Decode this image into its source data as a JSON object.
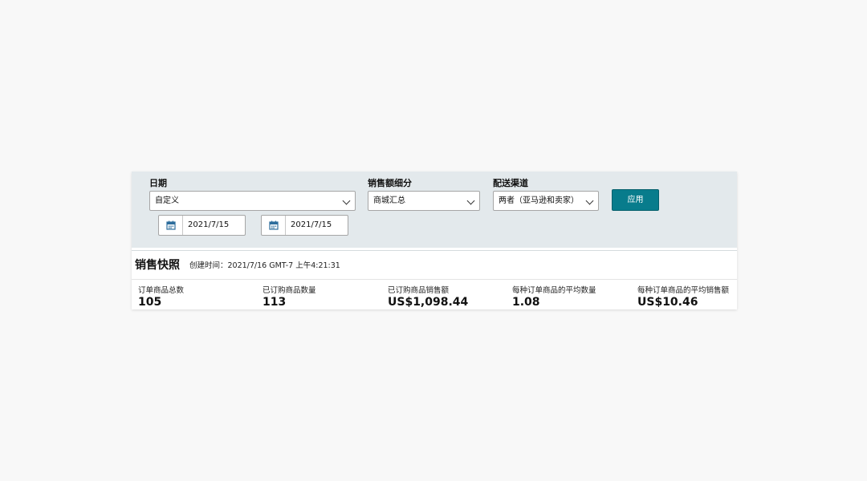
{
  "filters": {
    "date": {
      "label": "日期",
      "selected": "自定义",
      "start_date": "2021/7/15",
      "end_date": "2021/7/15"
    },
    "sales_breakdown": {
      "label": "销售额细分",
      "selected": "商城汇总"
    },
    "fulfillment_channel": {
      "label": "配送渠道",
      "selected": "两者（亚马逊和卖家）"
    },
    "apply_label": "应用"
  },
  "snapshot": {
    "title": "销售快照",
    "created": "创建时间：2021/7/16 GMT-7 上午4:21:31",
    "metrics": [
      {
        "label": "订单商品总数",
        "value": "105"
      },
      {
        "label": "已订购商品数量",
        "value": "113"
      },
      {
        "label": "已订购商品销售额",
        "value": "US$1,098.44"
      },
      {
        "label": "每种订单商品的平均数量",
        "value": "1.08"
      },
      {
        "label": "每种订单商品的平均销售额",
        "value": "US$10.46"
      }
    ]
  },
  "colors": {
    "filter_background": "#e3e9ec",
    "apply_button": "#087c8c",
    "calendar_icon": "#2d6d9c"
  },
  "icons": [
    "calendar-icon",
    "chevron-down-icon"
  ]
}
